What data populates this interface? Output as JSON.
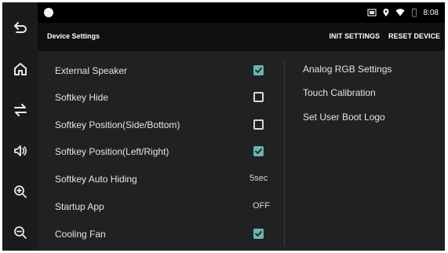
{
  "status_bar": {
    "time": "8:08"
  },
  "app_bar": {
    "title": "Device Settings",
    "actions": [
      "INIT SETTINGS",
      "RESET DEVICE"
    ]
  },
  "sidebar": {
    "buttons": [
      "back-icon",
      "home-icon",
      "swap-icon",
      "volume-icon",
      "zoom-in-icon",
      "zoom-out-icon"
    ]
  },
  "settings": [
    {
      "label": "External Speaker",
      "type": "checkbox",
      "checked": true
    },
    {
      "label": "Softkey Hide",
      "type": "checkbox",
      "checked": false
    },
    {
      "label": "Softkey Position(Side/Bottom)",
      "type": "checkbox",
      "checked": false
    },
    {
      "label": "Softkey Position(Left/Right)",
      "type": "checkbox",
      "checked": true
    },
    {
      "label": "Softkey Auto Hiding",
      "type": "value",
      "value": "5sec"
    },
    {
      "label": "Startup App",
      "type": "value",
      "value": "OFF"
    },
    {
      "label": "Cooling Fan",
      "type": "checkbox",
      "checked": true
    }
  ],
  "right_menu": [
    "Analog RGB Settings",
    "Touch Calibration",
    "Set User Boot Logo"
  ],
  "colors": {
    "accent": "#66b6b2",
    "background": "#202123",
    "app_bar": "#0f1011"
  }
}
